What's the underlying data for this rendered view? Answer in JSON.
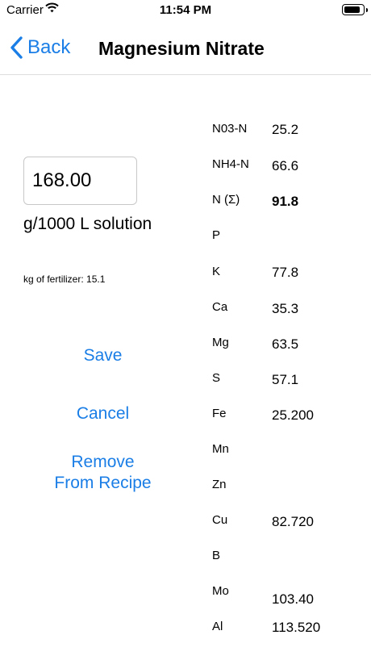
{
  "status": {
    "carrier": "Carrier",
    "time": "11:54 PM"
  },
  "nav": {
    "back_label": "Back",
    "title": "Magnesium Nitrate"
  },
  "amount": {
    "value": "168.00",
    "unit": "g/1000 L solution",
    "kg_text": "kg of fertilizer: 15.1"
  },
  "actions": {
    "save": "Save",
    "cancel": "Cancel",
    "remove_line1": "Remove",
    "remove_line2": "From Recipe"
  },
  "elements": [
    {
      "name": "N03-N",
      "value": "25.2"
    },
    {
      "name": "NH4-N",
      "value": "66.6"
    },
    {
      "name": "N (Σ)",
      "value": "91.8"
    },
    {
      "name": "P",
      "value": ""
    },
    {
      "name": "K",
      "value": "77.8"
    },
    {
      "name": "Ca",
      "value": "35.3"
    },
    {
      "name": "Mg",
      "value": "63.5"
    },
    {
      "name": "S",
      "value": "57.1"
    },
    {
      "name": "Fe",
      "value": "25.200"
    },
    {
      "name": "Mn",
      "value": ""
    },
    {
      "name": "Zn",
      "value": ""
    },
    {
      "name": "Cu",
      "value": "82.720"
    },
    {
      "name": "B",
      "value": ""
    },
    {
      "name": "Mo",
      "value": "103.40"
    },
    {
      "name": "Al",
      "value": "113.520"
    }
  ],
  "colors": {
    "accent": "#1a7ee6"
  }
}
